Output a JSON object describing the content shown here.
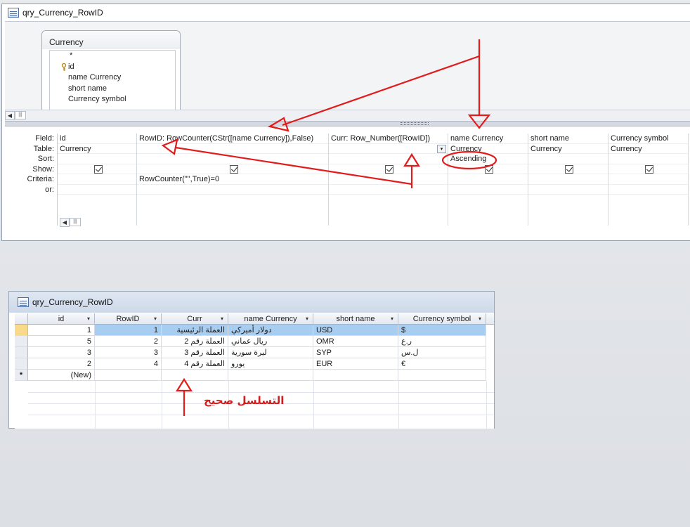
{
  "design": {
    "title": "qry_Currency_RowID",
    "table": {
      "name": "Currency",
      "fields": [
        "*",
        "id",
        "name Currency",
        "short name",
        "Currency symbol"
      ]
    },
    "row_labels": [
      "Field:",
      "Table:",
      "Sort:",
      "Show:",
      "Criteria:",
      "or:"
    ],
    "columns": [
      {
        "field": "id",
        "table": "Currency",
        "sort": "",
        "show": true,
        "criteria": ""
      },
      {
        "field": "RowID: RowCounter(CStr([name Currency]),False)",
        "table": "",
        "sort": "",
        "show": true,
        "criteria": "RowCounter(\"\",True)=0"
      },
      {
        "field": "Curr: Row_Number([RowID])",
        "table": "",
        "sort": "",
        "show": true,
        "criteria": ""
      },
      {
        "field": "name Currency",
        "table": "Currency",
        "sort": "Ascending",
        "show": true,
        "criteria": ""
      },
      {
        "field": "short name",
        "table": "Currency",
        "sort": "",
        "show": true,
        "criteria": ""
      },
      {
        "field": "Currency symbol",
        "table": "Currency",
        "sort": "",
        "show": true,
        "criteria": ""
      }
    ]
  },
  "sheet": {
    "title": "qry_Currency_RowID",
    "headers": [
      "id",
      "RowID",
      "Curr",
      "name Currency",
      "short name",
      "Currency symbol"
    ],
    "rows": [
      {
        "id": "1",
        "rowid": "1",
        "curr": "العملة الرئيسية",
        "name": "دولار أميركي",
        "short": "USD",
        "symbol": "$"
      },
      {
        "id": "5",
        "rowid": "2",
        "curr": "العملة رقم 2",
        "name": "ريال عماني",
        "short": "OMR",
        "symbol": "ر.ع"
      },
      {
        "id": "3",
        "rowid": "3",
        "curr": "العملة رقم 3",
        "name": "ليرة سورية",
        "short": "SYP",
        "symbol": "ل.س"
      },
      {
        "id": "2",
        "rowid": "4",
        "curr": "العملة رقم 4",
        "name": "يورو",
        "short": "EUR",
        "symbol": "€"
      }
    ],
    "new_row_label": "(New)",
    "new_row_marker": "*"
  },
  "annotation": {
    "note": "التسلسل صحيح",
    "color": "#d21d1d"
  }
}
